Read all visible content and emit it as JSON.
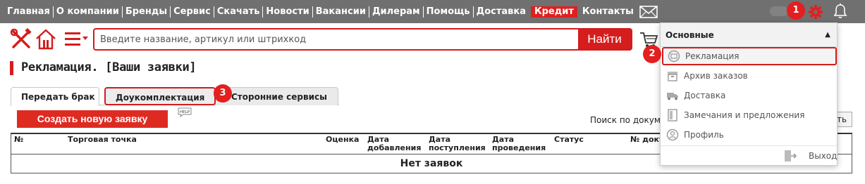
{
  "nav": {
    "items": [
      "Главная",
      "О компании",
      "Бренды",
      "Сервис",
      "Скачать",
      "Новости",
      "Вакансии",
      "Дилерам",
      "Помощь",
      "Доставка",
      "Кредит",
      "Контакты"
    ]
  },
  "search": {
    "placeholder": "Введите название, артикул или штрихкод",
    "button": "Найти"
  },
  "page": {
    "title": "Рекламация. [Ваши заявки]"
  },
  "tabs": [
    "Передать брак",
    "Доукомплектация",
    "Сторонние сервисы"
  ],
  "actions": {
    "create": "Создать новую заявку",
    "help": "HELP",
    "doc_search_label": "Поиск по документу",
    "doc_search_button": "ть"
  },
  "table": {
    "headers": [
      "№",
      "Торговая точка",
      "Оценка",
      "Дата добавления",
      "Дата поступления",
      "Дата проведения",
      "Статус",
      "№ документа"
    ],
    "empty": "Нет заявок"
  },
  "dropdown": {
    "header": "Основные",
    "items": [
      "Рекламация",
      "Архив заказов",
      "Доставка",
      "Замечания и предложения",
      "Профиль"
    ],
    "exit": "Выход"
  },
  "badges": [
    "1",
    "2",
    "3"
  ],
  "colors": {
    "nav_bg": "#707070",
    "accent": "#d51d1d",
    "credit": "#e02020"
  }
}
